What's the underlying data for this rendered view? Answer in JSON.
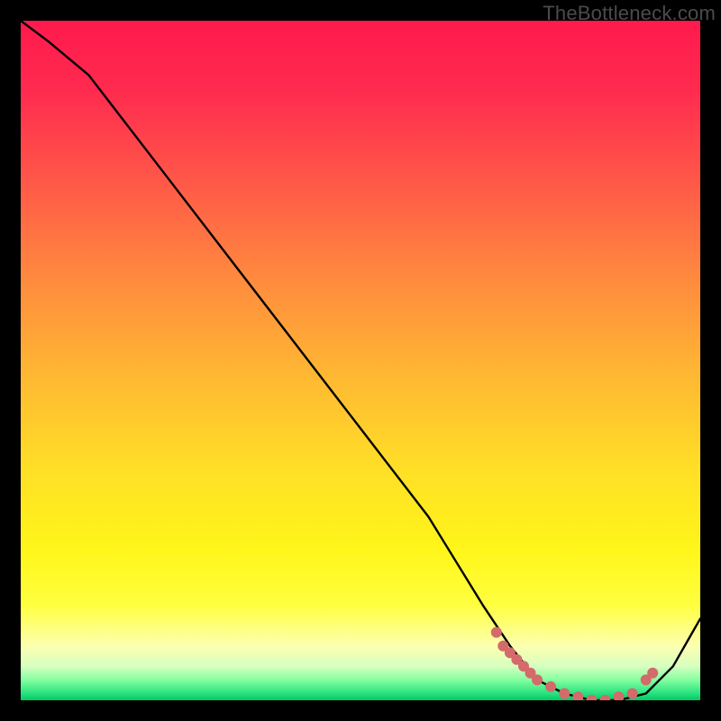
{
  "watermark": "TheBottleneck.com",
  "chart_data": {
    "type": "line",
    "title": "",
    "xlabel": "",
    "ylabel": "",
    "xlim": [
      0,
      100
    ],
    "ylim": [
      0,
      100
    ],
    "series": [
      {
        "name": "bottleneck-curve",
        "x": [
          0,
          4,
          10,
          20,
          30,
          40,
          50,
          60,
          68,
          72,
          76,
          80,
          84,
          88,
          92,
          96,
          100
        ],
        "y": [
          100,
          97,
          92,
          79,
          66,
          53,
          40,
          27,
          14,
          8,
          3,
          1,
          0,
          0,
          1,
          5,
          12
        ]
      }
    ],
    "markers": {
      "name": "highlight-cluster",
      "x": [
        70,
        71,
        72,
        73,
        74,
        75,
        76,
        78,
        80,
        82,
        84,
        86,
        88,
        90,
        92,
        93
      ],
      "y": [
        10,
        8,
        7,
        6,
        5,
        4,
        3,
        2,
        1,
        0.5,
        0,
        0,
        0.5,
        1,
        3,
        4
      ]
    },
    "gradient_stops": [
      {
        "pos": 0.0,
        "color": "#ff1a4d"
      },
      {
        "pos": 0.1,
        "color": "#ff2a4f"
      },
      {
        "pos": 0.24,
        "color": "#ff5948"
      },
      {
        "pos": 0.38,
        "color": "#ff8a3e"
      },
      {
        "pos": 0.52,
        "color": "#ffb733"
      },
      {
        "pos": 0.66,
        "color": "#ffdf26"
      },
      {
        "pos": 0.78,
        "color": "#fff61a"
      },
      {
        "pos": 0.86,
        "color": "#ffff40"
      },
      {
        "pos": 0.92,
        "color": "#fcffb0"
      },
      {
        "pos": 0.95,
        "color": "#d7ffc0"
      },
      {
        "pos": 0.97,
        "color": "#84ffa0"
      },
      {
        "pos": 0.99,
        "color": "#28e27e"
      },
      {
        "pos": 1.0,
        "color": "#00c864"
      }
    ]
  }
}
